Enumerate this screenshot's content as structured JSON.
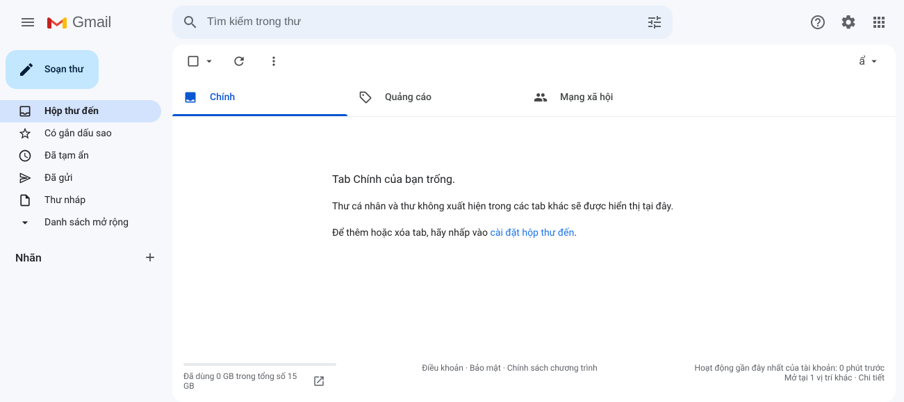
{
  "header": {
    "logo_text": "Gmail",
    "search_placeholder": "Tìm kiếm trong thư"
  },
  "compose": {
    "label": "Soạn thư"
  },
  "sidebar": {
    "items": [
      {
        "label": "Hộp thư đến"
      },
      {
        "label": "Có gắn dấu sao"
      },
      {
        "label": "Đã tạm ẩn"
      },
      {
        "label": "Đã gửi"
      },
      {
        "label": "Thư nháp"
      },
      {
        "label": "Danh sách mở rộng"
      }
    ],
    "labels_title": "Nhãn"
  },
  "tabs": [
    {
      "label": "Chính"
    },
    {
      "label": "Quảng cáo"
    },
    {
      "label": "Mạng xã hội"
    }
  ],
  "empty": {
    "line1": "Tab Chính của bạn trống.",
    "line2": "Thư cá nhân và thư không xuất hiện trong các tab khác sẽ được hiển thị tại đây.",
    "line3_pre": "Để thêm hoặc xóa tab, hãy nhấp vào ",
    "line3_link": "cài đặt hộp thư đến",
    "line3_suffix": "."
  },
  "footer": {
    "storage": "Đã dùng 0 GB trong tổng số 15 GB",
    "terms": "Điều khoản",
    "privacy": "Bảo mật",
    "policies": "Chính sách chương trình",
    "activity": "Hoạt động gần đây nhất của tài khoản: 0 phút trước",
    "open_elsewhere": "Mở tại 1 vị trí khác",
    "details": "Chi tiết",
    "sep": " · "
  }
}
